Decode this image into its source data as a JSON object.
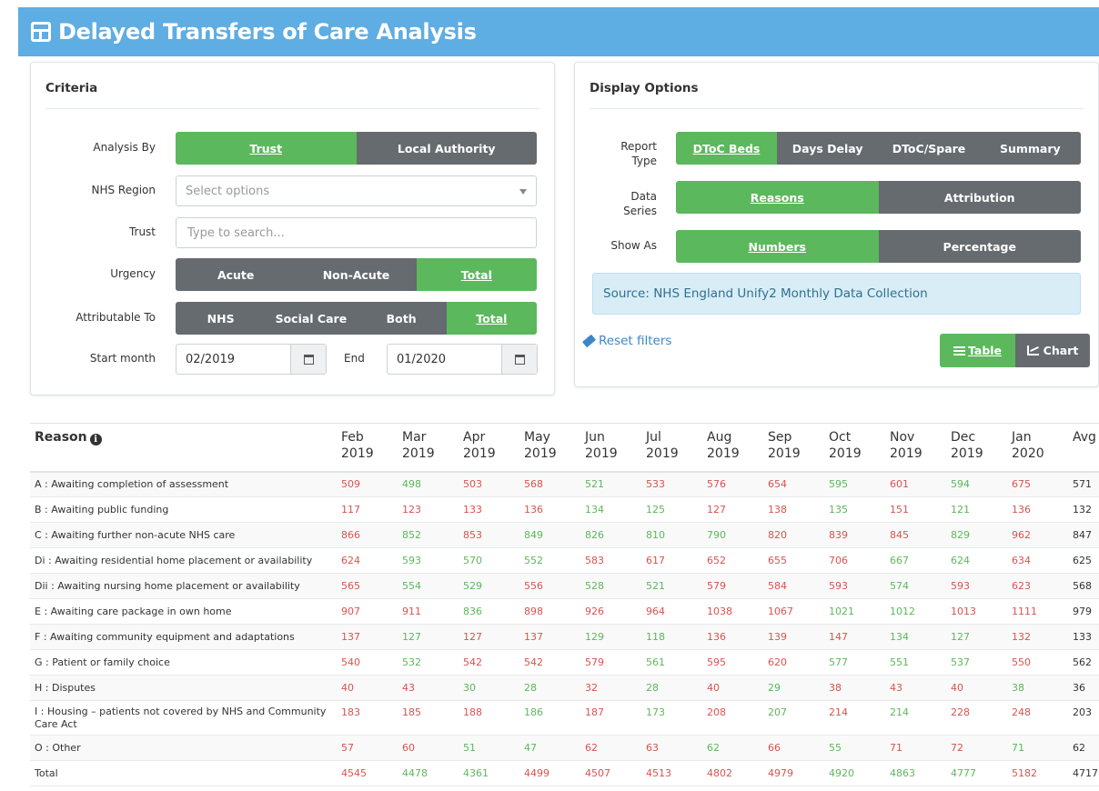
{
  "header": {
    "title": "Delayed Transfers of Care Analysis"
  },
  "criteria": {
    "title": "Criteria",
    "analysis_by": {
      "label": "Analysis By",
      "options": [
        "Trust",
        "Local Authority"
      ],
      "selected": "Trust"
    },
    "nhs_region": {
      "label": "NHS Region",
      "placeholder": "Select options"
    },
    "trust": {
      "label": "Trust",
      "placeholder": "Type to search..."
    },
    "urgency": {
      "label": "Urgency",
      "options": [
        "Acute",
        "Non-Acute",
        "Total"
      ],
      "selected": "Total"
    },
    "attributable": {
      "label": "Attributable To",
      "options": [
        "NHS",
        "Social Care",
        "Both",
        "Total"
      ],
      "selected": "Total"
    },
    "start": {
      "label": "Start month",
      "value": "02/2019"
    },
    "end": {
      "label": "End",
      "value": "01/2020"
    }
  },
  "display": {
    "title": "Display Options",
    "report_type": {
      "label_line1": "Report",
      "label_line2": "Type",
      "options": [
        "DToC Beds",
        "Days Delay",
        "DToC/Spare",
        "Summary"
      ],
      "selected": "DToC Beds"
    },
    "data_series": {
      "label_line1": "Data",
      "label_line2": "Series",
      "options": [
        "Reasons",
        "Attribution"
      ],
      "selected": "Reasons"
    },
    "show_as": {
      "label": "Show As",
      "options": [
        "Numbers",
        "Percentage"
      ],
      "selected": "Numbers"
    },
    "source": "Source: NHS England Unify2 Monthly Data Collection",
    "reset": "Reset filters",
    "view_table": "Table",
    "view_chart": "Chart"
  },
  "table": {
    "reason_header": "Reason",
    "columns": [
      [
        "Feb",
        "2019"
      ],
      [
        "Mar",
        "2019"
      ],
      [
        "Apr",
        "2019"
      ],
      [
        "May",
        "2019"
      ],
      [
        "Jun",
        "2019"
      ],
      [
        "Jul",
        "2019"
      ],
      [
        "Aug",
        "2019"
      ],
      [
        "Sep",
        "2019"
      ],
      [
        "Oct",
        "2019"
      ],
      [
        "Nov",
        "2019"
      ],
      [
        "Dec",
        "2019"
      ],
      [
        "Jan",
        "2020"
      ]
    ],
    "avg_header": "Avg",
    "colors": {
      "up": "#d9534f",
      "down": "#5cb85c"
    },
    "rows": [
      {
        "reason": "A : Awaiting completion of assessment",
        "values": [
          "509",
          "498",
          "503",
          "568",
          "521",
          "533",
          "576",
          "654",
          "595",
          "601",
          "594",
          "675"
        ],
        "dirs": [
          "u",
          "d",
          "u",
          "u",
          "d",
          "u",
          "u",
          "u",
          "d",
          "u",
          "d",
          "u"
        ],
        "avg": "571"
      },
      {
        "reason": "B : Awaiting public funding",
        "values": [
          "117",
          "123",
          "133",
          "136",
          "134",
          "125",
          "127",
          "138",
          "135",
          "151",
          "121",
          "136"
        ],
        "dirs": [
          "u",
          "u",
          "u",
          "u",
          "d",
          "d",
          "u",
          "u",
          "d",
          "u",
          "d",
          "u"
        ],
        "avg": "132"
      },
      {
        "reason": "C : Awaiting further non-acute NHS care",
        "values": [
          "866",
          "852",
          "853",
          "849",
          "826",
          "810",
          "790",
          "820",
          "839",
          "845",
          "829",
          "962"
        ],
        "dirs": [
          "u",
          "d",
          "u",
          "d",
          "d",
          "d",
          "d",
          "u",
          "u",
          "u",
          "d",
          "u"
        ],
        "avg": "847"
      },
      {
        "reason": "Di : Awaiting residential home placement or availability",
        "values": [
          "624",
          "593",
          "570",
          "552",
          "583",
          "617",
          "652",
          "655",
          "706",
          "667",
          "624",
          "634"
        ],
        "dirs": [
          "u",
          "d",
          "d",
          "d",
          "u",
          "u",
          "u",
          "u",
          "u",
          "d",
          "d",
          "u"
        ],
        "avg": "625"
      },
      {
        "reason": "Dii : Awaiting nursing home placement or availability",
        "values": [
          "565",
          "554",
          "529",
          "556",
          "528",
          "521",
          "579",
          "584",
          "593",
          "574",
          "593",
          "623"
        ],
        "dirs": [
          "u",
          "d",
          "d",
          "u",
          "d",
          "d",
          "u",
          "u",
          "u",
          "d",
          "u",
          "u"
        ],
        "avg": "568"
      },
      {
        "reason": "E : Awaiting care package in own home",
        "values": [
          "907",
          "911",
          "836",
          "898",
          "926",
          "964",
          "1038",
          "1067",
          "1021",
          "1012",
          "1013",
          "1111"
        ],
        "dirs": [
          "u",
          "u",
          "d",
          "u",
          "u",
          "u",
          "u",
          "u",
          "d",
          "d",
          "u",
          "u"
        ],
        "avg": "979"
      },
      {
        "reason": "F : Awaiting community equipment and adaptations",
        "values": [
          "137",
          "127",
          "127",
          "137",
          "129",
          "118",
          "136",
          "139",
          "147",
          "134",
          "127",
          "132"
        ],
        "dirs": [
          "u",
          "d",
          "u",
          "u",
          "d",
          "d",
          "u",
          "u",
          "u",
          "d",
          "d",
          "u"
        ],
        "avg": "133"
      },
      {
        "reason": "G : Patient or family choice",
        "values": [
          "540",
          "532",
          "542",
          "542",
          "579",
          "561",
          "595",
          "620",
          "577",
          "551",
          "537",
          "550"
        ],
        "dirs": [
          "u",
          "d",
          "u",
          "u",
          "u",
          "d",
          "u",
          "u",
          "d",
          "d",
          "d",
          "u"
        ],
        "avg": "562"
      },
      {
        "reason": "H : Disputes",
        "values": [
          "40",
          "43",
          "30",
          "28",
          "32",
          "28",
          "40",
          "29",
          "38",
          "43",
          "40",
          "38"
        ],
        "dirs": [
          "u",
          "u",
          "d",
          "d",
          "u",
          "d",
          "u",
          "d",
          "u",
          "u",
          "u",
          "d"
        ],
        "avg": "36"
      },
      {
        "reason": "I : Housing – patients not covered by NHS and Community Care Act",
        "values": [
          "183",
          "185",
          "188",
          "186",
          "187",
          "173",
          "208",
          "207",
          "214",
          "214",
          "228",
          "248"
        ],
        "dirs": [
          "u",
          "u",
          "u",
          "d",
          "u",
          "d",
          "u",
          "d",
          "u",
          "d",
          "u",
          "u"
        ],
        "avg": "203"
      },
      {
        "reason": "O : Other",
        "values": [
          "57",
          "60",
          "51",
          "47",
          "62",
          "63",
          "62",
          "66",
          "55",
          "71",
          "72",
          "71"
        ],
        "dirs": [
          "u",
          "u",
          "d",
          "d",
          "u",
          "u",
          "d",
          "u",
          "d",
          "u",
          "u",
          "d"
        ],
        "avg": "62"
      },
      {
        "reason": "Total",
        "values": [
          "4545",
          "4478",
          "4361",
          "4499",
          "4507",
          "4513",
          "4802",
          "4979",
          "4920",
          "4863",
          "4777",
          "5182"
        ],
        "dirs": [
          "u",
          "d",
          "d",
          "u",
          "u",
          "u",
          "u",
          "u",
          "d",
          "d",
          "d",
          "u"
        ],
        "avg": "4717"
      }
    ]
  }
}
